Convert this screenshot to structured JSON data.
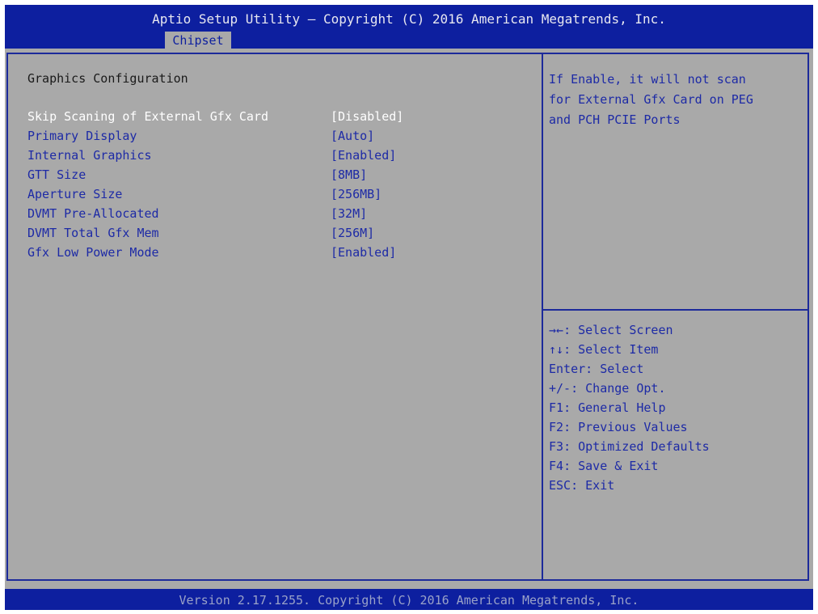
{
  "header": {
    "title": "Aptio Setup Utility – Copyright (C) 2016 American Megatrends, Inc.",
    "active_tab": "Chipset"
  },
  "main": {
    "section_title": "Graphics Configuration",
    "options": [
      {
        "label": "Skip Scaning of External Gfx Card",
        "value": "[Disabled]",
        "selected": true
      },
      {
        "label": "Primary Display",
        "value": "[Auto]",
        "selected": false
      },
      {
        "label": "Internal Graphics",
        "value": "[Enabled]",
        "selected": false
      },
      {
        "label": "GTT Size",
        "value": "[8MB]",
        "selected": false
      },
      {
        "label": "Aperture Size",
        "value": "[256MB]",
        "selected": false
      },
      {
        "label": "DVMT Pre-Allocated",
        "value": "[32M]",
        "selected": false
      },
      {
        "label": "DVMT Total Gfx Mem",
        "value": "[256M]",
        "selected": false
      },
      {
        "label": "Gfx Low Power Mode",
        "value": "[Enabled]",
        "selected": false
      }
    ]
  },
  "help": {
    "lines": [
      "If Enable, it will not scan",
      "for External Gfx Card on PEG",
      "and PCH PCIE Ports"
    ]
  },
  "keys": [
    {
      "key": "→←",
      "desc": ": Select Screen"
    },
    {
      "key": "↑↓",
      "desc": ": Select Item"
    },
    {
      "key": "Enter",
      "desc": ": Select"
    },
    {
      "key": "+/-",
      "desc": ": Change Opt."
    },
    {
      "key": "F1",
      "desc": ": General Help"
    },
    {
      "key": "F2",
      "desc": ": Previous Values"
    },
    {
      "key": "F3",
      "desc": ": Optimized Defaults"
    },
    {
      "key": "F4",
      "desc": ": Save & Exit"
    },
    {
      "key": "ESC",
      "desc": ": Exit"
    }
  ],
  "footer": {
    "text": "Version 2.17.1255. Copyright (C) 2016 American Megatrends, Inc."
  },
  "colors": {
    "header_blue": "#0d1f9f",
    "panel_gray": "#a9a9a9",
    "text_blue": "#1d2aa6",
    "selected_text": "#ffffff"
  }
}
